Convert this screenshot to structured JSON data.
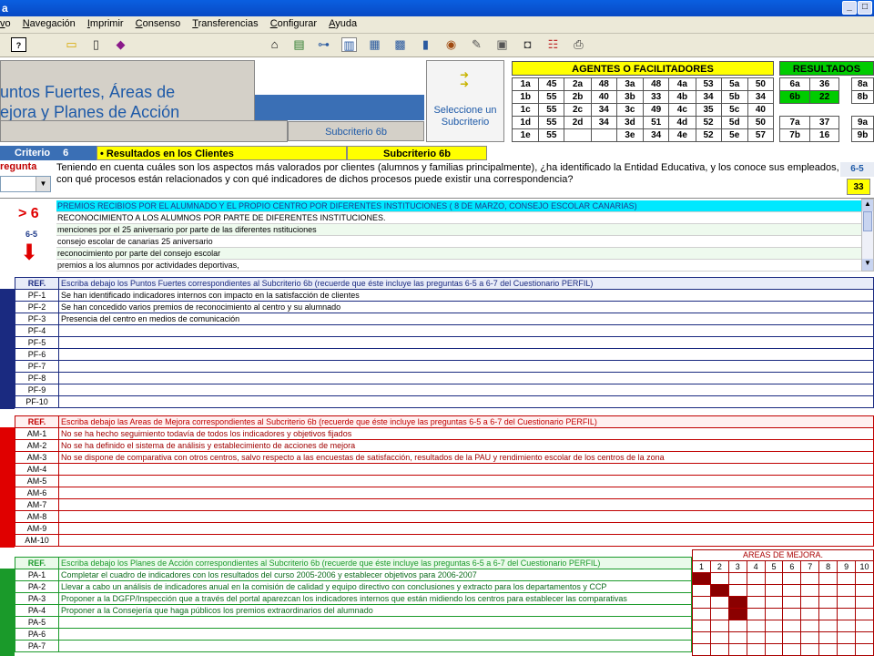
{
  "window": {
    "title": "a"
  },
  "menu": [
    "vo",
    "Navegación",
    "Imprimir",
    "Consenso",
    "Transferencias",
    "Configurar",
    "Ayuda"
  ],
  "header": {
    "title_line1": "untos Fuertes, Áreas de",
    "title_line2": "ejora y Planes de Acción",
    "subcriterio_label": "Subcriterio 6b",
    "select_label": "Seleccione un Subcriterio"
  },
  "agents": {
    "title": "AGENTES O FACILITADORES",
    "rows": [
      [
        "1a",
        "45",
        "2a",
        "48",
        "3a",
        "48",
        "4a",
        "53",
        "5a",
        "50"
      ],
      [
        "1b",
        "55",
        "2b",
        "40",
        "3b",
        "33",
        "4b",
        "34",
        "5b",
        "34"
      ],
      [
        "1c",
        "55",
        "2c",
        "34",
        "3c",
        "49",
        "4c",
        "35",
        "5c",
        "40"
      ],
      [
        "1d",
        "55",
        "2d",
        "34",
        "3d",
        "51",
        "4d",
        "52",
        "5d",
        "50"
      ],
      [
        "1e",
        "55",
        "",
        "",
        "3e",
        "34",
        "4e",
        "52",
        "5e",
        "57"
      ]
    ]
  },
  "results": {
    "title": "RESULTADOS",
    "rows": [
      [
        "6a",
        "36",
        "8a"
      ],
      [
        "6b",
        "22",
        "8b"
      ],
      [
        "",
        "",
        ""
      ],
      [
        "7a",
        "37",
        "9a"
      ],
      [
        "7b",
        "16",
        "9b"
      ]
    ]
  },
  "criterio": {
    "label": "Criterio",
    "number": "6",
    "name": "• Resultados en los Clientes",
    "sub": "Subcriterio 6b"
  },
  "question": {
    "label": "regunta",
    "text": "Teniendo en cuenta cuáles son los aspectos más valorados por clientes (alumnos y familias principalmente), ¿ha identificado la Entidad Educativa, y los conoce sus empleados, con qué procesos están relacionados y con qué indicadores de dichos procesos puede existir una correspondencia?",
    "code": "6-5",
    "score": "33"
  },
  "evidence": {
    "flag": "> 6",
    "code": "6-5",
    "rows": [
      "PREMIOS RECIBIOS POR EL ALUMNADO Y EL PROPIO CENTRO POR DIFERENTES INSTITUCIONES ( 8 DE MARZO, CONSEJO ESCOLAR CANARIAS)",
      "RECONOCIMIENTO A LOS ALUMNOS POR PARTE DE DIFERENTES INSTITUCIONES.",
      "menciones por el 25 aniversario por parte  de las  diferentes nstituciones",
      "consejo escolar de canarias 25 aniversario",
      "reconocimiento por parte del consejo escolar",
      "premios a los alumnos por actividades deportivas,"
    ]
  },
  "pf": {
    "ref": "REF.",
    "header": "Escriba debajo los Puntos Fuertes correspondientes al Subcriterio 6b (recuerde que éste incluye las preguntas 6-5 a 6-7 del Cuestionario PERFIL)",
    "rows": [
      [
        "PF-1",
        "Se han identificado indicadores internos con impacto en la satisfacción de clientes"
      ],
      [
        "PF-2",
        "Se han concedido varios premios de reconocimiento al centro y su alumnado"
      ],
      [
        "PF-3",
        "Presencia del centro en medios de comunicación"
      ],
      [
        "PF-4",
        ""
      ],
      [
        "PF-5",
        ""
      ],
      [
        "PF-6",
        ""
      ],
      [
        "PF-7",
        ""
      ],
      [
        "PF-8",
        ""
      ],
      [
        "PF-9",
        ""
      ],
      [
        "PF-10",
        ""
      ]
    ]
  },
  "am": {
    "ref": "REF.",
    "header": "Escriba debajo las Areas de Mejora correspondientes al Subcriterio 6b (recuerde que éste incluye las preguntas 6-5 a 6-7 del Cuestionario PERFIL)",
    "rows": [
      [
        "AM-1",
        "No se ha hecho seguimiento todavía de todos los indicadores y objetivos fijados"
      ],
      [
        "AM-2",
        "No se ha definido el sistema de análisis y establecimiento de acciones de mejora"
      ],
      [
        "AM-3",
        "No se dispone de comparativa con otros centros, salvo respecto a las encuestas de satisfacción, resultados de la PAU y rendimiento escolar de los centros de la zona"
      ],
      [
        "AM-4",
        ""
      ],
      [
        "AM-5",
        ""
      ],
      [
        "AM-6",
        ""
      ],
      [
        "AM-7",
        ""
      ],
      [
        "AM-8",
        ""
      ],
      [
        "AM-9",
        ""
      ],
      [
        "AM-10",
        ""
      ]
    ]
  },
  "pa": {
    "ref": "REF.",
    "header": "Escriba debajo los Planes de Acción correspondientes al Subcriterio 6b (recuerde que éste incluye las preguntas 6-5 a 6-7 del Cuestionario PERFIL)",
    "rows": [
      [
        "PA-1",
        "Completar el cuadro de indicadores con los resultados del curso 2005-2006 y establecer objetivos para 2006-2007"
      ],
      [
        "PA-2",
        "Llevar a cabo un análisis de indicadores anual en la comisión de calidad y equipo directivo con conclusiones y extracto para los departamentos y CCP"
      ],
      [
        "PA-3",
        "Proponer a la DGFP/Inspección que a través del portal aparezcan los indicadores internos que están midiendo los centros para establecer las comparativas"
      ],
      [
        "PA-4",
        "Proponer a la Consejería que haga públicos los premios extraordinarios del alumnado"
      ],
      [
        "PA-5",
        ""
      ],
      [
        "PA-6",
        ""
      ],
      [
        "PA-7",
        ""
      ]
    ]
  },
  "areas": {
    "title": "AREAS DE MEJORA.",
    "cols": [
      "1",
      "2",
      "3",
      "4",
      "5",
      "6",
      "7",
      "8",
      "9",
      "10"
    ],
    "marks": [
      [
        0
      ],
      [
        1
      ],
      [
        2
      ],
      [
        2
      ],
      [],
      [],
      []
    ]
  }
}
